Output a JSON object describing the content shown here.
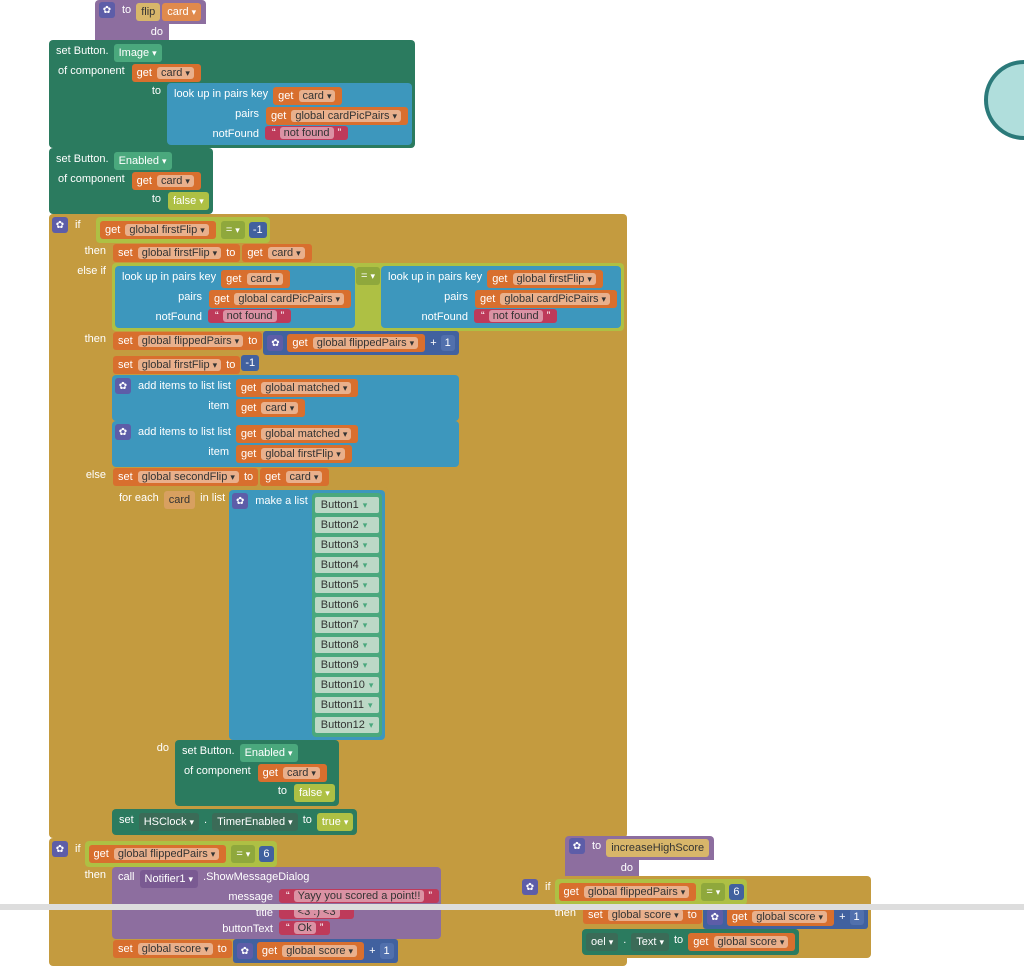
{
  "proc": {
    "to": "to",
    "name": "flip",
    "param": "card"
  },
  "do": "do",
  "setButton": {
    "label": "set Button.",
    "image": "Image",
    "of": "of component",
    "toLbl": "to",
    "enabled": "Enabled"
  },
  "get": "get",
  "set": "set",
  "card": "card",
  "lookup": {
    "label": "look up in pairs  key",
    "pairsLbl": "pairs",
    "nfLbl": "notFound",
    "nf": "not found"
  },
  "globals": {
    "cardPicPairs": "global cardPicPairs",
    "firstFlip": "global firstFlip",
    "flippedPairs": "global flippedPairs",
    "secondFlip": "global secondFlip",
    "matched": "global matched",
    "score": "global score"
  },
  "false": "false",
  "true": "true",
  "if": "if",
  "then": "then",
  "elseif": "else if",
  "else": "else",
  "eq": "=",
  "neg1": "-1",
  "one": "1",
  "six": "6",
  "plus": "+",
  "add": {
    "label": "add items to list   list",
    "item": "item"
  },
  "foreach": {
    "label": "for each",
    "in": "in list",
    "make": "make a list",
    "do": "do"
  },
  "buttons": [
    "Button1",
    "Button2",
    "Button3",
    "Button4",
    "Button5",
    "Button6",
    "Button7",
    "Button8",
    "Button9",
    "Button10",
    "Button11",
    "Button12"
  ],
  "hsclock": {
    "set": "set",
    "name": "HSClock",
    "prop": "TimerEnabled",
    "to": "to"
  },
  "call": "call",
  "notifier": {
    "name": "Notifier1",
    "method": ".ShowMessageDialog",
    "msg": "message",
    "title": "title",
    "btn": "buttonText"
  },
  "dlg": {
    "msg": "Yayy you scored a point!!",
    "title": "<3 :) <3",
    "ok": "Ok"
  },
  "proc2": {
    "name": "increaseHighScore",
    "oel": "oel",
    "text": "Text"
  }
}
